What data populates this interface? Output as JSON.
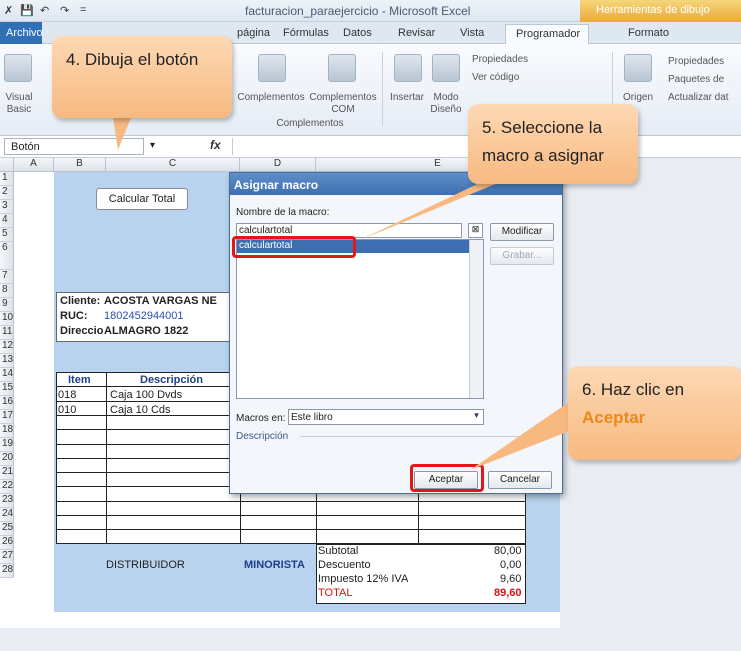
{
  "window": {
    "title": "facturacion_paraejercicio - Microsoft Excel",
    "tools_tab": "Herramientas de dibujo",
    "quick_access": [
      "✗",
      "💾",
      "↶",
      "↷",
      "="
    ]
  },
  "tabs": [
    "Archivo",
    "página",
    "Fórmulas",
    "Datos",
    "Revisar",
    "Vista",
    "Programador",
    "Formato"
  ],
  "ribbon": {
    "visual_basic": "Visual Basic",
    "complementos": "Complementos",
    "complementos_com": "Complementos COM",
    "group_complementos": "Complementos",
    "insertar": "Insertar",
    "modo_diseno": "Modo Diseño",
    "propiedades": "Propiedades",
    "ver_codigo": "Ver código",
    "origen": "Origen",
    "propiedades_xml": "Propiedades",
    "paquetes": "Paquetes de",
    "actualizar": "Actualizar dat"
  },
  "formula_bar": {
    "name_box": "Botón",
    "fx": "fx"
  },
  "sheet": {
    "columns": [
      "A",
      "B",
      "C",
      "D",
      "E"
    ],
    "rows": [
      "1",
      "2",
      "3",
      "4",
      "5",
      "6",
      "7",
      "8",
      "9",
      "10",
      "11",
      "12",
      "13",
      "14",
      "15",
      "16",
      "17",
      "18",
      "19",
      "20",
      "21",
      "22",
      "23",
      "24",
      "25",
      "26",
      "27",
      "28"
    ],
    "button_label": "Calcular Total",
    "cliente_label": "Cliente:",
    "cliente_value": "ACOSTA VARGAS NE",
    "ruc_label": "RUC:",
    "ruc_value": "1802452944001",
    "direccion_label": "Direccio",
    "direccion_value": "ALMAGRO 1822",
    "table_header_item": "Item",
    "table_header_desc": "Descripción",
    "items": [
      {
        "item": "018",
        "desc": "Caja 100 Dvds"
      },
      {
        "item": "010",
        "desc": "Caja 10 Cds"
      }
    ],
    "distribuidor": "DISTRIBUIDOR",
    "minorista": "MINORISTA",
    "totals": [
      {
        "label": "Subtotal",
        "value": "80,00"
      },
      {
        "label": "Descuento",
        "value": "0,00"
      },
      {
        "label": "Impuesto 12% IVA",
        "value": "9,60"
      },
      {
        "label": "TOTAL",
        "value": "89,60"
      }
    ]
  },
  "dialog": {
    "title": "Asignar macro",
    "name_label": "Nombre de la macro:",
    "name_value": "calculartotal",
    "list_items": [
      "calculartotal"
    ],
    "macros_in_label": "Macros en:",
    "macros_in_value": "Este libro",
    "description_label": "Descripción",
    "modify_button": "Modificar",
    "record_button": "Grabar...",
    "accept_button": "Aceptar",
    "cancel_button": "Cancelar"
  },
  "callouts": {
    "step4": "4. Dibuja el botón",
    "step5": "5. Seleccione la macro a asignar",
    "step6_prefix": "6. Haz clic en",
    "step6_highlight": "Aceptar"
  },
  "colors": {
    "accent": "#e9a93a",
    "highlight_red": "#e01818",
    "callout": "#f7b980",
    "select_blue": "#3d6fb0"
  }
}
